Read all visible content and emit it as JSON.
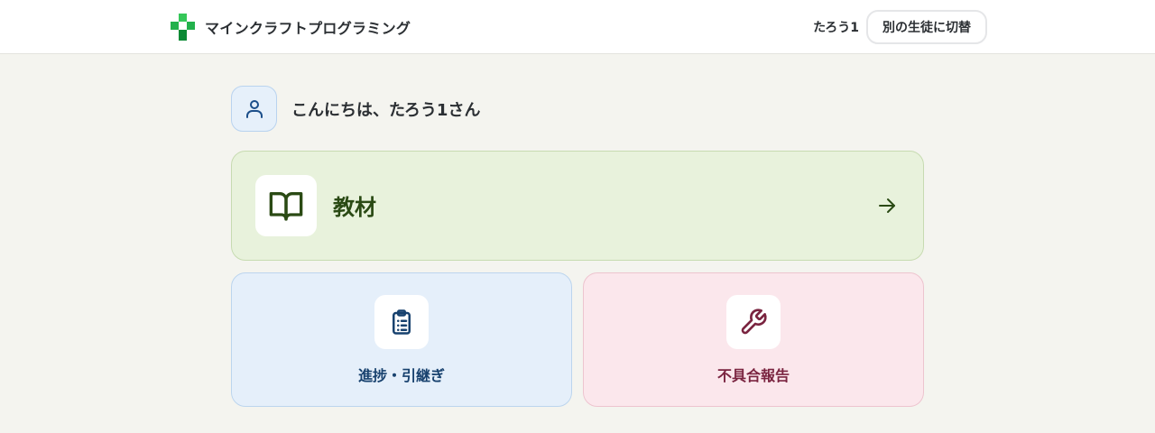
{
  "header": {
    "app_title": "マインクラフトプログラミング",
    "user_name": "たろう1",
    "switch_label": "別の生徒に切替",
    "logo_icon": "green-cross-logo",
    "logo_colors": [
      "#22b14c",
      "#35c759",
      "#0c8a35"
    ]
  },
  "greeting": {
    "text": "こんにちは、たろう1さん",
    "icon": "user-icon"
  },
  "cards": {
    "materials": {
      "label": "教材",
      "icon": "open-book-icon",
      "trailing_icon": "arrow-right-icon",
      "accent": "#2a4a14"
    },
    "progress": {
      "label": "進捗・引継ぎ",
      "icon": "clipboard-list-icon",
      "accent": "#17416e"
    },
    "report": {
      "label": "不具合報告",
      "icon": "wrench-icon",
      "accent": "#7a2440"
    }
  }
}
